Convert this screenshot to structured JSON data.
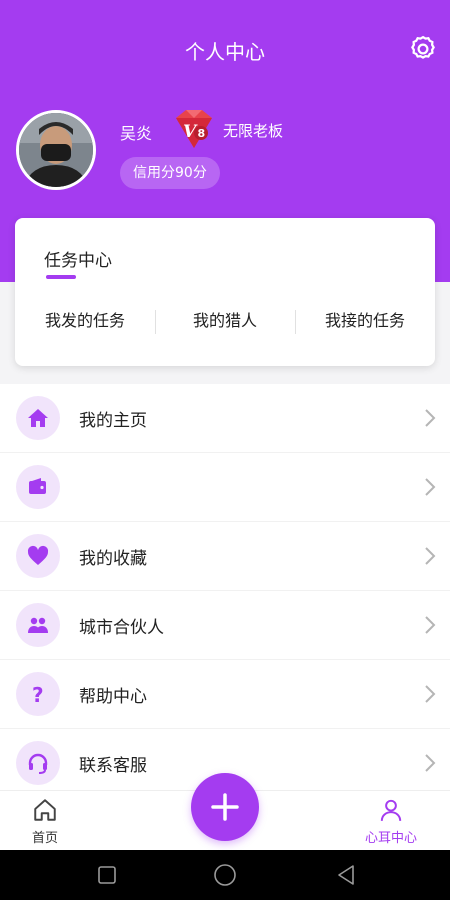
{
  "header": {
    "title": "个人中心",
    "settings_icon": "gear-icon",
    "background": "#a43cf0"
  },
  "profile": {
    "username": "吴炎",
    "vip_level": "8",
    "vip_label": "无限老板",
    "credit": "信用分90分"
  },
  "task_center": {
    "title": "任务中心",
    "tabs": [
      "我发的任务",
      "我的猎人",
      "我接的任务"
    ]
  },
  "menu": {
    "items": [
      {
        "label": "我的主页",
        "icon": "home-icon"
      },
      {
        "label": "",
        "icon": "wallet-icon"
      },
      {
        "label": "我的收藏",
        "icon": "heart-icon"
      },
      {
        "label": "城市合伙人",
        "icon": "partners-icon"
      },
      {
        "label": "帮助中心",
        "icon": "question-icon"
      },
      {
        "label": "联系客服",
        "icon": "headset-icon"
      }
    ]
  },
  "tabbar": {
    "home_label": "首页",
    "me_label": "心耳中心",
    "active_color": "#a43cf0"
  }
}
